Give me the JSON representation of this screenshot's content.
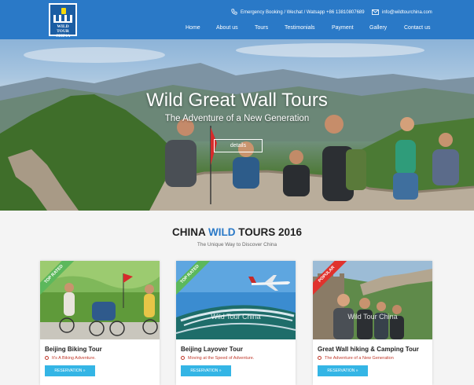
{
  "header": {
    "logo_text": [
      "WILD TOUR",
      "CHINA"
    ],
    "phone_text": "Emergency Booking / Wechat / Watsapp +86 13810807689",
    "email_text": "info@wildtourchina.com",
    "nav": [
      "Home",
      "About us",
      "Tours",
      "Testimonials",
      "Payment",
      "Gallery",
      "Contact us"
    ],
    "colors": {
      "bar": "#2a79c7"
    }
  },
  "hero": {
    "title": "Wild Great Wall Tours",
    "subtitle": "The Adventure of a New Generation",
    "button_label": "details"
  },
  "section": {
    "title_before": "CHINA ",
    "title_highlight": "WILD",
    "title_after": " TOURS 2016",
    "subtitle": "The Unique Way to Discover China"
  },
  "cards": [
    {
      "ribbon": "TOP RATED",
      "ribbon_color": "#5cb85c",
      "title": "Beijing Biking Tour",
      "tagline": "It's A Biking Adventure.",
      "button": "RESERVATION »",
      "watermark": ""
    },
    {
      "ribbon": "TOP RATED",
      "ribbon_color": "#5cb85c",
      "title": "Beijing Layover Tour",
      "tagline": "Moving at the Speed of Adventure.",
      "button": "RESERVATION »",
      "watermark": "Wild Tour China"
    },
    {
      "ribbon": "POPULAR",
      "ribbon_color": "#e0322d",
      "title": "Great Wall hiking & Camping Tour",
      "tagline": "The Adventure of a New Generation",
      "button": "RESERVATION »",
      "watermark": "Wild Tour China"
    }
  ],
  "icons": {
    "phone": "phone-icon",
    "email": "envelope-icon",
    "tagline": "circle-icon"
  }
}
